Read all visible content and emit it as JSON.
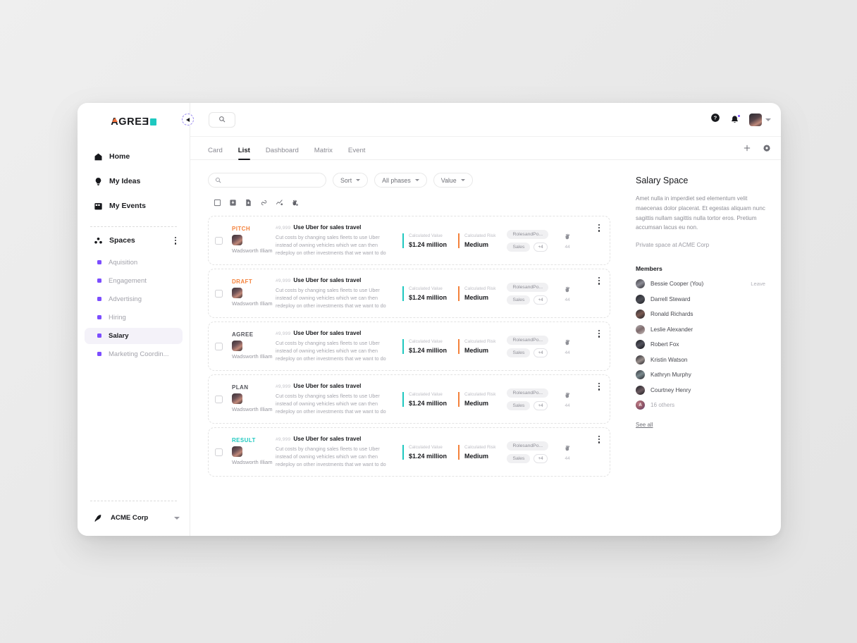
{
  "brand": {
    "name": "AGRE3D",
    "text_main": "AGRE",
    "text_rev": "Ǝ",
    "accent_orange": "#f2703b",
    "accent_teal": "#1ec8c0"
  },
  "sidebar": {
    "nav": [
      {
        "label": "Home",
        "icon": "home-icon"
      },
      {
        "label": "My Ideas",
        "icon": "lightbulb-icon"
      },
      {
        "label": "My Events",
        "icon": "calendar-icon"
      }
    ],
    "spaces_header": {
      "label": "Spaces",
      "icon": "spaces-icon",
      "menu_icon": "kebab-menu-icon"
    },
    "spaces": [
      {
        "label": "Aquisition",
        "active": false
      },
      {
        "label": "Engagement",
        "active": false
      },
      {
        "label": "Advertising",
        "active": false
      },
      {
        "label": "Hiring",
        "active": false
      },
      {
        "label": "Salary",
        "active": true
      },
      {
        "label": "Marketing Coordin...",
        "active": false
      }
    ],
    "org": {
      "name": "ACME Corp",
      "icon": "acme-logo-icon",
      "caret": "chevron-down-icon"
    }
  },
  "topbar": {
    "collapse_icon": "collapse-sidebar-icon",
    "search_icon": "search-icon",
    "help_icon": "help-circle-icon",
    "notifications_icon": "bell-icon",
    "avatar_icon": "user-avatar",
    "avatar_caret": "chevron-down-icon"
  },
  "tabs": {
    "items": [
      {
        "label": "Card",
        "active": false
      },
      {
        "label": "List",
        "active": true
      },
      {
        "label": "Dashboard",
        "active": false
      },
      {
        "label": "Matrix",
        "active": false
      },
      {
        "label": "Event",
        "active": false
      }
    ],
    "add_icon": "plus-icon",
    "settings_icon": "gear-icon"
  },
  "filters": {
    "search": {
      "value": "",
      "placeholder": ""
    },
    "sort": {
      "label": "Sort"
    },
    "phases": {
      "label": "All phases"
    },
    "value": {
      "label": "Value"
    }
  },
  "toolbar_icons": [
    "select-all-checkbox-icon",
    "archive-icon",
    "export-file-icon",
    "share-link-icon",
    "chart-share-icon",
    "clap-globe-icon"
  ],
  "list": {
    "rows": [
      {
        "phase": "PITCH",
        "phase_color": "#f4823c",
        "author": "Wadsworth Illiam",
        "id": "#9,999",
        "title": "Use Uber for sales travel",
        "desc": "Cut costs by changing sales fleets to use Uber instead of owning vehicles which we can then redeploy on other investments that we want to do",
        "value_label": "Calculated Value",
        "value": "$1.24 million",
        "risk_label": "Calculated Risk",
        "risk": "Medium",
        "tags": [
          "RolesandPo...",
          "Sales"
        ],
        "tag_more": "+4",
        "claps": "44"
      },
      {
        "phase": "DRAFT",
        "phase_color": "#f4823c",
        "author": "Wadsworth Illiam",
        "id": "#9,999",
        "title": "Use Uber for sales travel",
        "desc": "Cut costs by changing sales fleets to use Uber instead of owning vehicles which we can then redeploy on other investments that we want to do",
        "value_label": "Calculated Value",
        "value": "$1.24 million",
        "risk_label": "Calculated Risk",
        "risk": "Medium",
        "tags": [
          "RolesandPo...",
          "Sales"
        ],
        "tag_more": "+4",
        "claps": "44"
      },
      {
        "phase": "AGREE",
        "phase_color": "#55565d",
        "author": "Wadsworth Illiam",
        "id": "#9,999",
        "title": "Use Uber for sales travel",
        "desc": "Cut costs by changing sales fleets to use Uber instead of owning vehicles which we can then redeploy on other investments that we want to do",
        "value_label": "Calculated Value",
        "value": "$1.24 million",
        "risk_label": "Calculated Risk",
        "risk": "Medium",
        "tags": [
          "RolesandPo...",
          "Sales"
        ],
        "tag_more": "+4",
        "claps": "44"
      },
      {
        "phase": "PLAN",
        "phase_color": "#55565d",
        "author": "Wadsworth Illiam",
        "id": "#9,999",
        "title": "Use Uber for sales travel",
        "desc": "Cut costs by changing sales fleets to use Uber instead of owning vehicles which we can then redeploy on other investments that we want to do",
        "value_label": "Calculated Value",
        "value": "$1.24 million",
        "risk_label": "Calculated Risk",
        "risk": "Medium",
        "tags": [
          "RolesandPo...",
          "Sales"
        ],
        "tag_more": "+4",
        "claps": "44"
      },
      {
        "phase": "RESULT",
        "phase_color": "#1ec8c0",
        "author": "Wadsworth Illiam",
        "id": "#9,999",
        "title": "Use Uber for sales travel",
        "desc": "Cut costs by changing sales fleets to use Uber instead of owning vehicles which we can then redeploy on other investments that we want to do",
        "value_label": "Calculated Value",
        "value": "$1.24 million",
        "risk_label": "Calculated Risk",
        "risk": "Medium",
        "tags": [
          "RolesandPo...",
          "Sales"
        ],
        "tag_more": "+4",
        "claps": "44"
      }
    ]
  },
  "detail": {
    "title": "Salary Space",
    "description": "Amet nulla in imperdiet sed elementum velit maecenas dolor placerat. Et egestas aliquam nunc sagittis nullam sagittis nulla tortor eros. Pretium accumsan lacus eu non.",
    "subtitle": "Private space at ACME Corp",
    "members_heading": "Members",
    "members": [
      {
        "name": "Bessie Cooper (You)",
        "action": "Leave",
        "muted": false
      },
      {
        "name": "Darrell Steward",
        "action": "",
        "muted": false
      },
      {
        "name": "Ronald Richards",
        "action": "",
        "muted": false
      },
      {
        "name": "Leslie Alexander",
        "action": "",
        "muted": false
      },
      {
        "name": "Robert  Fox",
        "action": "",
        "muted": false
      },
      {
        "name": "Kristin Watson",
        "action": "",
        "muted": false
      },
      {
        "name": "Kathryn Murphy",
        "action": "",
        "muted": false
      },
      {
        "name": "Courtney Henry",
        "action": "",
        "muted": false
      },
      {
        "name": "16 others",
        "action": "",
        "muted": true
      }
    ],
    "see_all": "See all"
  }
}
